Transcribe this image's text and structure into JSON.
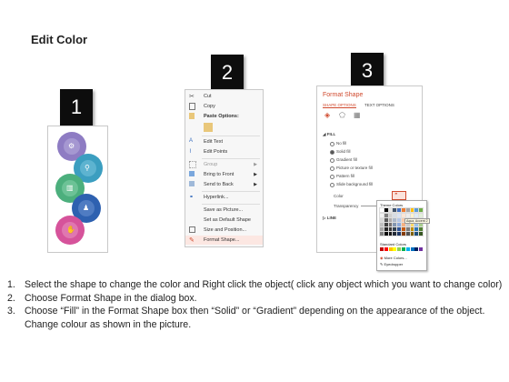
{
  "title": "Edit Color",
  "steps": {
    "one": "1",
    "two": "2",
    "three": "3"
  },
  "shapes": {
    "circles": [
      {
        "color": "#8e7cc3",
        "icon": "gear-icon"
      },
      {
        "color": "#3b9ec0",
        "icon": "search-icon"
      },
      {
        "color": "#4caf7d",
        "icon": "building-icon"
      },
      {
        "color": "#2e61b0",
        "icon": "people-icon"
      },
      {
        "color": "#d6539b",
        "icon": "thumbs-up-icon"
      }
    ]
  },
  "context_menu": {
    "items": [
      {
        "label": "Cut",
        "icon": "scissors-icon"
      },
      {
        "label": "Copy",
        "icon": "copy-icon"
      },
      {
        "label": "Paste Options:",
        "icon": "paste-icon"
      },
      {
        "label": "Edit Text",
        "icon": "edit-text-icon"
      },
      {
        "label": "Edit Points",
        "icon": "edit-points-icon"
      },
      {
        "label": "Group",
        "icon": "group-icon",
        "submenu": true
      },
      {
        "label": "Bring to Front",
        "icon": "bring-front-icon",
        "submenu": true
      },
      {
        "label": "Send to Back",
        "icon": "send-back-icon",
        "submenu": true
      },
      {
        "label": "Hyperlink...",
        "icon": "link-icon"
      },
      {
        "label": "Save as Picture...",
        "icon": ""
      },
      {
        "label": "Set as Default Shape",
        "icon": ""
      },
      {
        "label": "Size and Position...",
        "icon": "size-icon"
      },
      {
        "label": "Format Shape...",
        "icon": "format-shape-icon",
        "highlighted": true
      }
    ]
  },
  "format_shape": {
    "title": "Format Shape",
    "tabs": [
      "SHAPE OPTIONS",
      "TEXT OPTIONS"
    ],
    "fill_header": "FILL",
    "fill_options": [
      "No fill",
      "Solid fill",
      "Gradient fill",
      "Picture or texture fill",
      "Pattern fill",
      "Slide background fill"
    ],
    "selected_fill": "Solid fill",
    "color_label": "Color",
    "transparency_label": "Transparency",
    "transparency_value": "0%",
    "line_header": "LINE",
    "palette": {
      "theme_label": "Theme Colors",
      "accent_tooltip": "Aqua, Accent 2",
      "standard_label": "Standard Colors",
      "more_colors": "More Colors...",
      "eyedropper": "Eyedropper"
    }
  },
  "instructions": [
    {
      "num": "1.",
      "text": "Select the shape to change the color and Right click the object( click any object which you want to change color)"
    },
    {
      "num": "2.",
      "text": "Choose Format Shape in the dialog box."
    },
    {
      "num": "3.",
      "text": "Choose “Fill” in the Format Shape box then “Solid” or “Gradient” depending on the appearance of the object. Change colour as shown in the picture."
    }
  ]
}
